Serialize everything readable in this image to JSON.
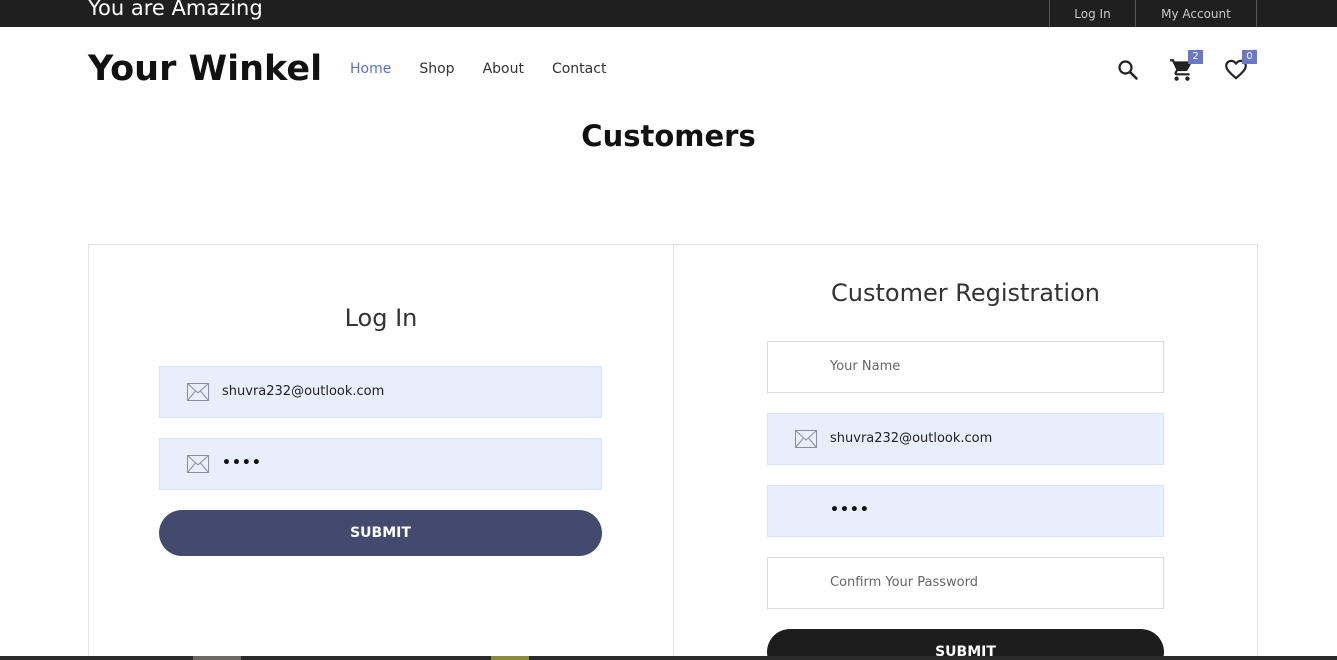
{
  "topbar": {
    "tagline": "You are Amazing",
    "login_label": "Log In",
    "account_label": "My Account"
  },
  "header": {
    "logo": "Your Winkel",
    "nav": [
      "Home",
      "Shop",
      "About",
      "Contact"
    ],
    "active_nav": "Home",
    "cart_count": "2",
    "wishlist_count": "0",
    "icons": [
      "search-icon",
      "cart-icon",
      "heart-icon"
    ]
  },
  "page": {
    "title": "Customers"
  },
  "login": {
    "title": "Log In",
    "email_value": "shuvra232@outlook.com",
    "password_value": "••••",
    "submit_label": "SUBMIT"
  },
  "register": {
    "title": "Customer Registration",
    "name_placeholder": "Your Name",
    "email_value": "shuvra232@outlook.com",
    "password_value": "••••",
    "confirm_placeholder": "Confirm Your Password",
    "submit_label": "SUBMIT"
  },
  "colors": {
    "accent": "#5a6fc9",
    "badge": "#6a78c6",
    "login_button": "#434a6e",
    "register_button": "#1d1d1d",
    "filled_field": "#e8eefb"
  }
}
